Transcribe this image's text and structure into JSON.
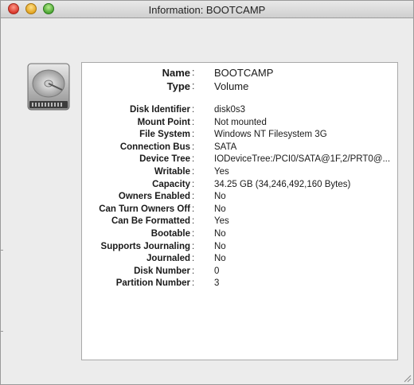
{
  "window": {
    "title": "Information: BOOTCAMP"
  },
  "disk_icon": "hard-drive-icon",
  "info": {
    "head": [
      {
        "label": "Name",
        "value": "BOOTCAMP"
      },
      {
        "label": "Type",
        "value": "Volume"
      }
    ],
    "details": [
      {
        "label": "Disk Identifier",
        "value": "disk0s3"
      },
      {
        "label": "Mount Point",
        "value": "Not mounted"
      },
      {
        "label": "File System",
        "value": "Windows NT Filesystem 3G"
      },
      {
        "label": "Connection Bus",
        "value": "SATA"
      },
      {
        "label": "Device Tree",
        "value": "IODeviceTree:/PCI0/SATA@1F,2/PRT0@..."
      },
      {
        "label": "Writable",
        "value": "Yes"
      },
      {
        "label": "Capacity",
        "value": "34.25 GB (34,246,492,160 Bytes)"
      },
      {
        "label": "Owners Enabled",
        "value": "No"
      },
      {
        "label": "Can Turn Owners Off",
        "value": "No"
      },
      {
        "label": "Can Be Formatted",
        "value": "Yes"
      },
      {
        "label": "Bootable",
        "value": "No"
      },
      {
        "label": "Supports Journaling",
        "value": "No"
      },
      {
        "label": "Journaled",
        "value": "No"
      },
      {
        "label": "Disk Number",
        "value": "0"
      },
      {
        "label": "Partition Number",
        "value": "3"
      }
    ],
    "colon": ":"
  }
}
